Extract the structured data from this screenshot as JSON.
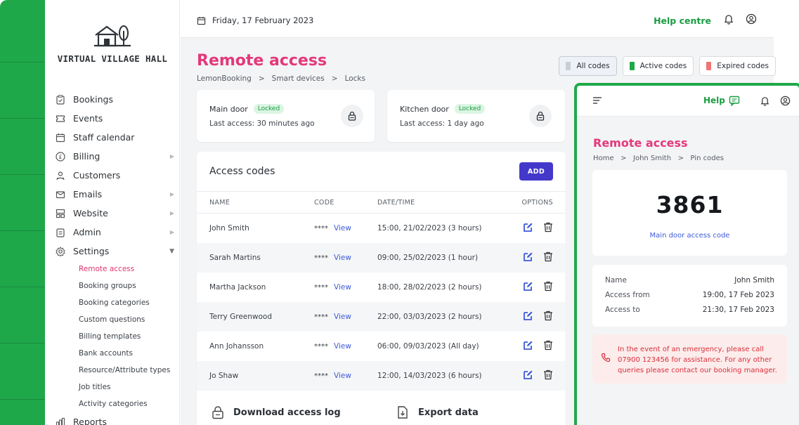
{
  "app": {
    "logo_text": "VIRTUAL VILLAGE HALL",
    "accent": "#1fa84a",
    "brand_pink": "#e3397a",
    "primary_button": "#4338ca"
  },
  "sidebar": {
    "items": [
      {
        "label": "Bookings",
        "icon": "clipboard-icon"
      },
      {
        "label": "Events",
        "icon": "ticket-icon"
      },
      {
        "label": "Staff calendar",
        "icon": "calendar-icon"
      },
      {
        "label": "Billing",
        "icon": "pound-icon",
        "expandable": true
      },
      {
        "label": "Customers",
        "icon": "users-icon"
      },
      {
        "label": "Emails",
        "icon": "mail-icon",
        "expandable": true
      },
      {
        "label": "Website",
        "icon": "website-icon",
        "expandable": true
      },
      {
        "label": "Admin",
        "icon": "admin-icon",
        "expandable": true
      },
      {
        "label": "Settings",
        "icon": "gear-icon",
        "expanded": true
      }
    ],
    "settings_sub": [
      "Remote access",
      "Booking groups",
      "Booking categories",
      "Custom questions",
      "Billing templates",
      "Bank accounts",
      "Resource/Attribute types",
      "Job titles",
      "Activity categories"
    ],
    "reports": {
      "label": "Reports",
      "icon": "bar-chart-icon"
    }
  },
  "topbar": {
    "date": "Friday, 17 February 2023",
    "help": "Help centre"
  },
  "page": {
    "title": "Remote access",
    "breadcrumb": [
      "LemonBooking",
      "Smart devices",
      "Locks"
    ],
    "filters": [
      {
        "label": "All codes",
        "color": "#c9ced6"
      },
      {
        "label": "Active codes",
        "color": "#1fa84a"
      },
      {
        "label": "Expired codes",
        "color": "#f07474"
      }
    ]
  },
  "doors": [
    {
      "name": "Main door",
      "status": "Locked",
      "last_access": "Last access: 30 minutes ago"
    },
    {
      "name": "Kitchen door",
      "status": "Locked",
      "last_access": "Last access: 1 day ago"
    }
  ],
  "access_codes": {
    "title": "Access codes",
    "add_label": "ADD",
    "columns": [
      "NAME",
      "CODE",
      "DATE/TIME",
      "OPTIONS"
    ],
    "rows": [
      {
        "name": "John Smith",
        "code": "****",
        "view": "View",
        "datetime": "15:00, 21/02/2023 (3 hours)"
      },
      {
        "name": "Sarah Martins",
        "code": "****",
        "view": "View",
        "datetime": "09:00, 25/02/2023 (1 hour)"
      },
      {
        "name": "Martha Jackson",
        "code": "****",
        "view": "View",
        "datetime": "18:00, 28/02/2023 (2 hours)"
      },
      {
        "name": "Terry Greenwood",
        "code": "****",
        "view": "View",
        "datetime": "22:00, 03/03/2023 (2 hours)"
      },
      {
        "name": "Ann Johansson",
        "code": "****",
        "view": "View",
        "datetime": "06:00, 09/03/2023 (All day)"
      },
      {
        "name": "Jo Shaw",
        "code": "****",
        "view": "View",
        "datetime": "12:00, 14/03/2023 (6 hours)"
      }
    ]
  },
  "actions": {
    "download": "Download access log",
    "export": "Export data"
  },
  "mobile": {
    "help": "Help",
    "title": "Remote access",
    "breadcrumb": [
      "Home",
      "John Smith",
      "Pin codes"
    ],
    "pin": "3861",
    "pin_label": "Main door access code",
    "details": [
      {
        "k": "Name",
        "v": "John Smith"
      },
      {
        "k": "Access from",
        "v": "19:00, 17 Feb 2023"
      },
      {
        "k": "Access to",
        "v": "21:30, 17 Feb 2023"
      }
    ],
    "alert": "In the event of an emergency, please call 07900 123456 for assistance. For any other queries please contact our booking manager."
  }
}
